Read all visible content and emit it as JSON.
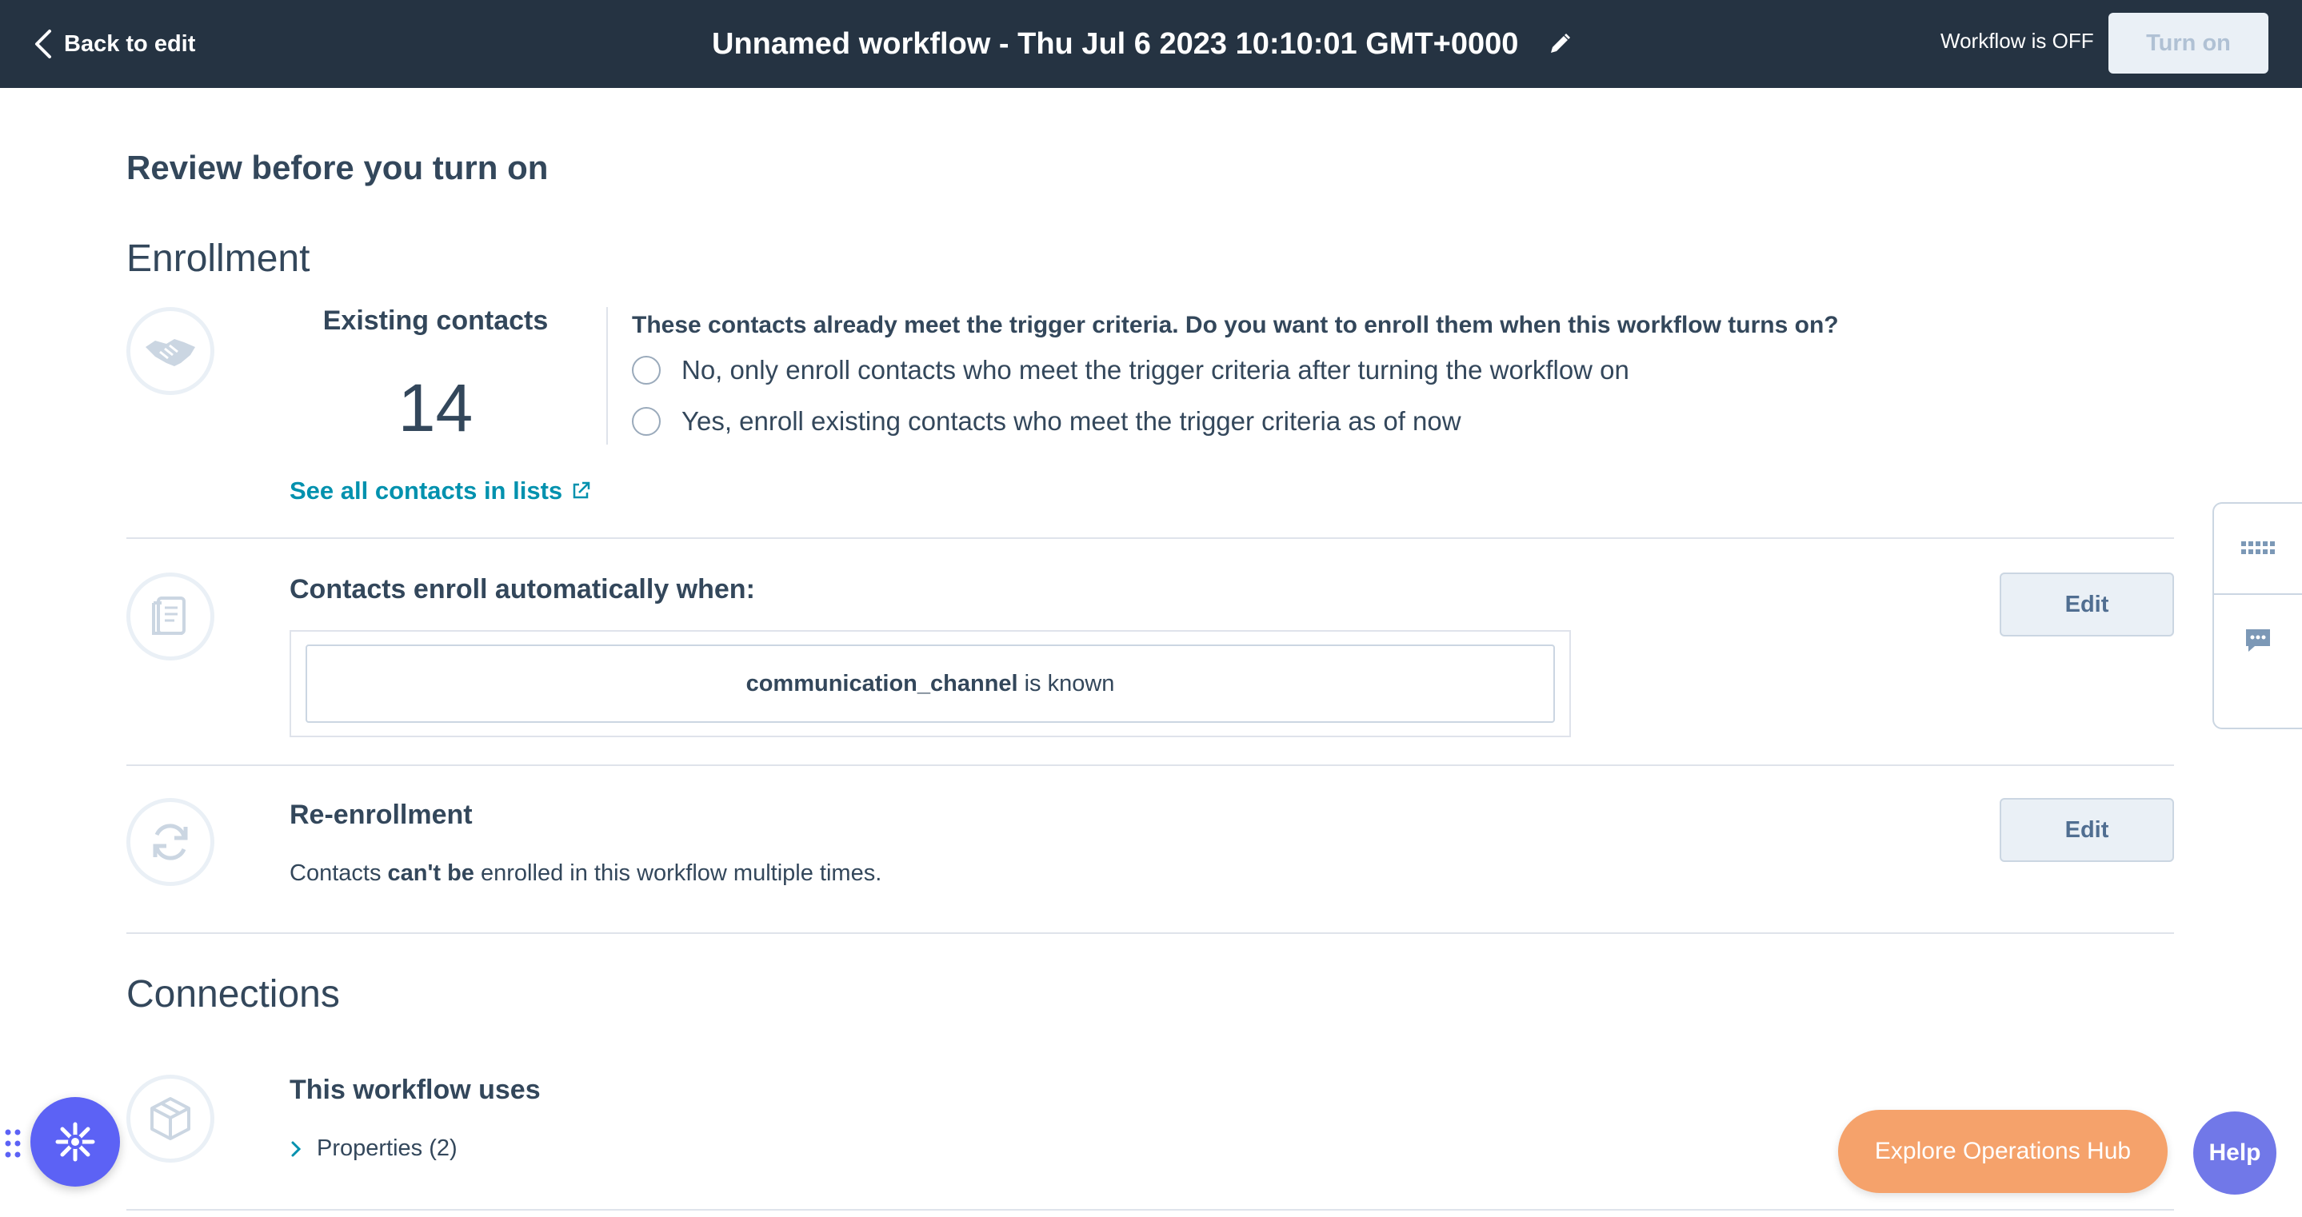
{
  "header": {
    "back_label": "Back to edit",
    "title": "Unnamed workflow - Thu Jul 6 2023 10:10:01 GMT+0000",
    "status": "Workflow is OFF",
    "turn_on_label": "Turn on"
  },
  "review": {
    "heading": "Review before you turn on"
  },
  "enrollment": {
    "heading": "Enrollment",
    "existing_label": "Existing contacts",
    "existing_count": "14",
    "question": "These contacts already meet the trigger criteria. Do you want to enroll them when this workflow turns on?",
    "options": [
      "No, only enroll contacts who meet the trigger criteria after turning the workflow on",
      "Yes, enroll existing contacts who meet the trigger criteria as of now"
    ],
    "see_all_label": "See all contacts in lists",
    "auto_heading": "Contacts enroll automatically when:",
    "criteria_property": "communication_channel",
    "criteria_condition": "is known",
    "edit_label": "Edit"
  },
  "reenrollment": {
    "heading": "Re-enrollment",
    "desc_prefix": "Contacts",
    "desc_bold": "can't be",
    "desc_suffix": "enrolled in this workflow multiple times.",
    "edit_label": "Edit"
  },
  "connections": {
    "heading": "Connections",
    "uses_heading": "This workflow uses",
    "properties_label": "Properties (2)"
  },
  "footer": {
    "explore_label": "Explore Operations Hub",
    "help_label": "Help"
  },
  "colors": {
    "topbar": "#253342",
    "text": "#33475b",
    "link": "#0091ae",
    "explore": "#f5a26b",
    "help": "#7178e8",
    "logo": "#5c62f5"
  },
  "icons": [
    "chevron-left-icon",
    "pencil-icon",
    "handshake-icon",
    "external-link-icon",
    "scroll-icon",
    "refresh-icon",
    "package-icon",
    "chevron-right-icon",
    "grid-dots-icon",
    "chat-icon",
    "drag-handle-icon",
    "sparkle-logo-icon"
  ]
}
